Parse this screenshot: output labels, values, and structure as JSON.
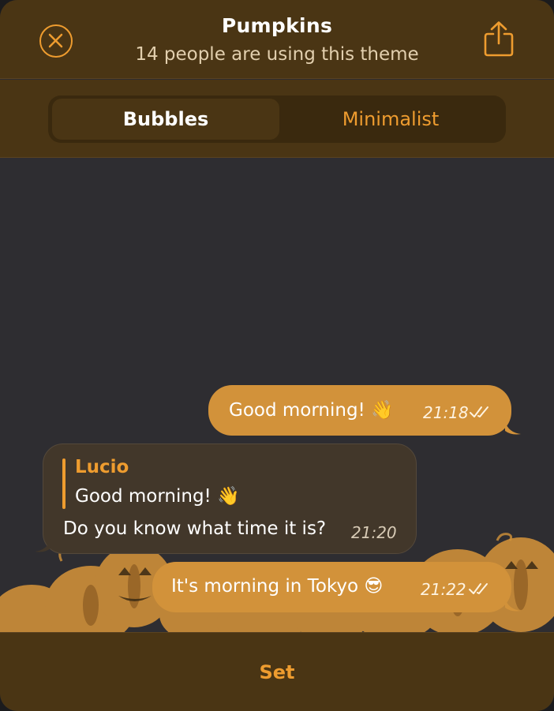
{
  "header": {
    "title": "Pumpkins",
    "subtitle": "14 people are using this theme",
    "close_icon": "close-circle-icon",
    "share_icon": "share-icon"
  },
  "tabs": [
    {
      "label": "Bubbles",
      "selected": true
    },
    {
      "label": "Minimalist",
      "selected": false
    }
  ],
  "messages": [
    {
      "direction": "outgoing",
      "text": "Good morning! 👋",
      "time": "21:18",
      "read": true
    },
    {
      "direction": "incoming",
      "reply_to": {
        "name": "Lucio",
        "text": "Good morning! 👋"
      },
      "text": "Do you know what time it is?",
      "time": "21:20"
    },
    {
      "direction": "outgoing",
      "text": "It's morning in Tokyo 😎",
      "time": "21:22",
      "read": true
    }
  ],
  "footer": {
    "set_label": "Set"
  },
  "colors": {
    "accent": "#ee9c2f",
    "header_bg": "#4a3514",
    "chat_bg": "#2e2d31",
    "outgoing_bubble": "#d2923a",
    "incoming_bubble": "#42372a"
  }
}
